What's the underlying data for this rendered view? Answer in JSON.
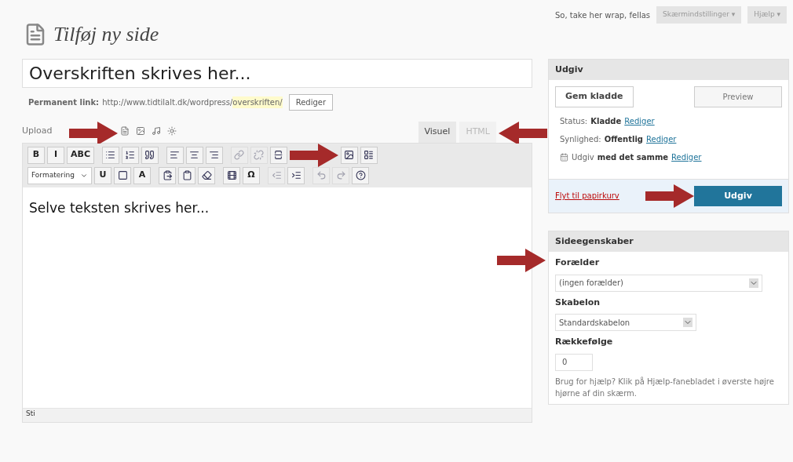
{
  "header": {
    "title": "Tilføj ny side",
    "greeting": "So, take her wrap, fellas",
    "tabs": [
      {
        "label": "Skærmindstillinger ▾"
      },
      {
        "label": "Hjælp ▾"
      }
    ]
  },
  "editor": {
    "title_value": "Overskriften skrives her...",
    "permalink": {
      "label": "Permanent link:",
      "base": "http://www.tidtilalt.dk/wordpress/",
      "slug": "overskriften/",
      "button": "Rediger"
    },
    "upload_label": "Upload",
    "tabs": [
      {
        "label": "Visuel",
        "selected": true
      },
      {
        "label": "HTML",
        "selected": false
      }
    ],
    "toolbar_rows": [
      [
        {
          "kind": "glyph",
          "label": "B",
          "disabled": false
        },
        {
          "kind": "glyph",
          "label": "I",
          "disabled": false
        },
        {
          "kind": "glyph",
          "label": "ABC",
          "disabled": false
        },
        {
          "kind": "sep"
        },
        {
          "kind": "icon",
          "disabled": false
        },
        {
          "kind": "icon",
          "disabled": false
        },
        {
          "kind": "icon",
          "disabled": false
        },
        {
          "kind": "sep"
        },
        {
          "kind": "icon",
          "disabled": false
        },
        {
          "kind": "icon",
          "disabled": false
        },
        {
          "kind": "icon",
          "disabled": false
        },
        {
          "kind": "sep"
        },
        {
          "kind": "icon",
          "disabled": true
        },
        {
          "kind": "icon",
          "disabled": true
        },
        {
          "kind": "icon",
          "disabled": false
        },
        {
          "kind": "icon",
          "disabled": false
        },
        {
          "kind": "icon",
          "disabled": false
        }
      ],
      [
        {
          "kind": "select",
          "label": "Formatering",
          "disabled": false
        },
        {
          "kind": "glyph",
          "label": "U",
          "disabled": false
        },
        {
          "kind": "icon",
          "disabled": false
        },
        {
          "kind": "glyph",
          "label": "A",
          "disabled": false
        },
        {
          "kind": "sep"
        },
        {
          "kind": "icon",
          "disabled": false
        },
        {
          "kind": "icon",
          "disabled": false
        },
        {
          "kind": "icon",
          "disabled": false
        },
        {
          "kind": "sep"
        },
        {
          "kind": "icon",
          "disabled": false
        },
        {
          "kind": "glyph",
          "label": "Ω",
          "disabled": false
        },
        {
          "kind": "sep"
        },
        {
          "kind": "icon",
          "disabled": true
        },
        {
          "kind": "icon",
          "disabled": false
        },
        {
          "kind": "sep"
        },
        {
          "kind": "icon",
          "disabled": true
        },
        {
          "kind": "icon",
          "disabled": true
        },
        {
          "kind": "icon",
          "disabled": false
        }
      ]
    ],
    "body": "Selve teksten skrives her...",
    "path": "Sti"
  },
  "publish": {
    "title": "Udgiv",
    "save_button": "Gem kladde",
    "preview_button": "Preview",
    "rows": [
      {
        "label": "Status:",
        "value": "Kladde",
        "link": "Rediger",
        "calendar": false
      },
      {
        "label": "Synlighed:",
        "value": "Offentlig",
        "link": "Rediger",
        "calendar": false
      },
      {
        "label": "Udgiv",
        "value": "med det samme",
        "link": "Rediger",
        "calendar": true
      }
    ],
    "trash_link": "Flyt til papirkurv",
    "publish_button": "Udgiv"
  },
  "page_attributes": {
    "title": "Sideegenskaber",
    "parent_label": "Forælder",
    "parent_value": "(ingen forælder)",
    "template_label": "Skabelon",
    "template_value": "Standardskabelon",
    "order_label": "Rækkefølge",
    "order_value": "0",
    "help": "Brug for hjælp? Klik på Hjælp-fanebladet i øverste højre hjørne af din skærm."
  }
}
